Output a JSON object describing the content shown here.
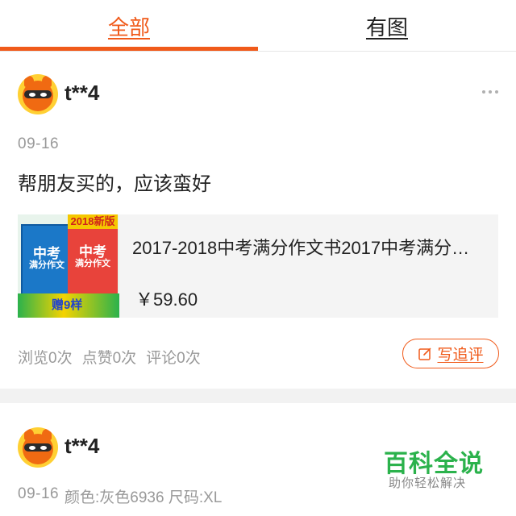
{
  "tabs": [
    {
      "label": "全部",
      "active": true
    },
    {
      "label": "有图",
      "active": false
    }
  ],
  "accent_color": "#f05a1a",
  "reviews": [
    {
      "username": "t**4",
      "avatar_icon": "orange-mascot-avatar",
      "date": "09-16",
      "content": "帮朋友买的，应该蛮好",
      "product": {
        "title": "2017-2018中考满分作文书2017中考满分作文",
        "price": "￥59.60",
        "thumb": {
          "tag": "2018新版",
          "book1_title": "中考",
          "book1_sub": "满分作文",
          "book2_title": "中考",
          "book2_sub": "满分作文",
          "gift": "赠9样"
        }
      },
      "stats": {
        "views": "浏览0次",
        "likes": "点赞0次",
        "comments": "评论0次"
      },
      "write_button": "写追评"
    },
    {
      "username": "t**4",
      "avatar_icon": "orange-mascot-avatar",
      "date": "09-16",
      "spec": "颜色:灰色6936 尺码:XL"
    }
  ],
  "watermark": {
    "title": "百科全说",
    "subtitle": "助你轻松解决"
  }
}
